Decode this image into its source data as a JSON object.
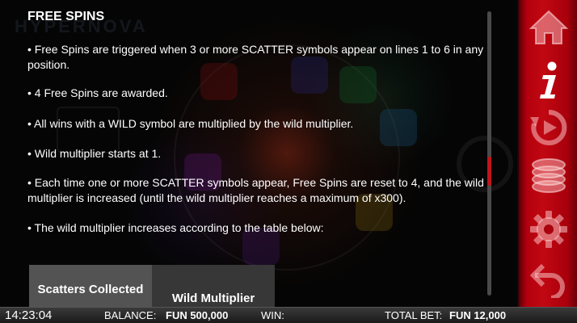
{
  "info": {
    "title": "FREE SPINS",
    "paragraphs": [
      "• Free Spins are triggered when 3 or more SCATTER symbols appear on lines 1 to 6 in any position.",
      "• 4 Free Spins are awarded.",
      "• All wins with a WILD symbol are multiplied by the wild multiplier.",
      "• Wild multiplier starts at 1.",
      "• Each time one or more SCATTER symbols appear, Free Spins are reset to 4, and the wild multiplier is increased (until the wild multiplier reaches a maximum of x300).",
      "• The wild multiplier increases according to the table below:"
    ],
    "table_headers": [
      "Scatters Collected",
      "Wild Multiplier"
    ]
  },
  "sidebar": {
    "home_icon": "home-icon",
    "info_icon": "info-icon",
    "replay_icon": "replay-icon",
    "coins_icon": "coins-icon",
    "settings_icon": "gear-icon",
    "back_icon": "back-icon"
  },
  "status_bar": {
    "clock": "14:23:04",
    "balance_label": "BALANCE:",
    "balance_value": "FUN 500,000",
    "win_label": "WIN:",
    "total_bet_label": "TOTAL BET:",
    "total_bet_value": "FUN 12,000"
  },
  "colors": {
    "accent": "#c10812",
    "scroll_thumb": "#c0141a",
    "status_bg": "#1a1a1a"
  }
}
